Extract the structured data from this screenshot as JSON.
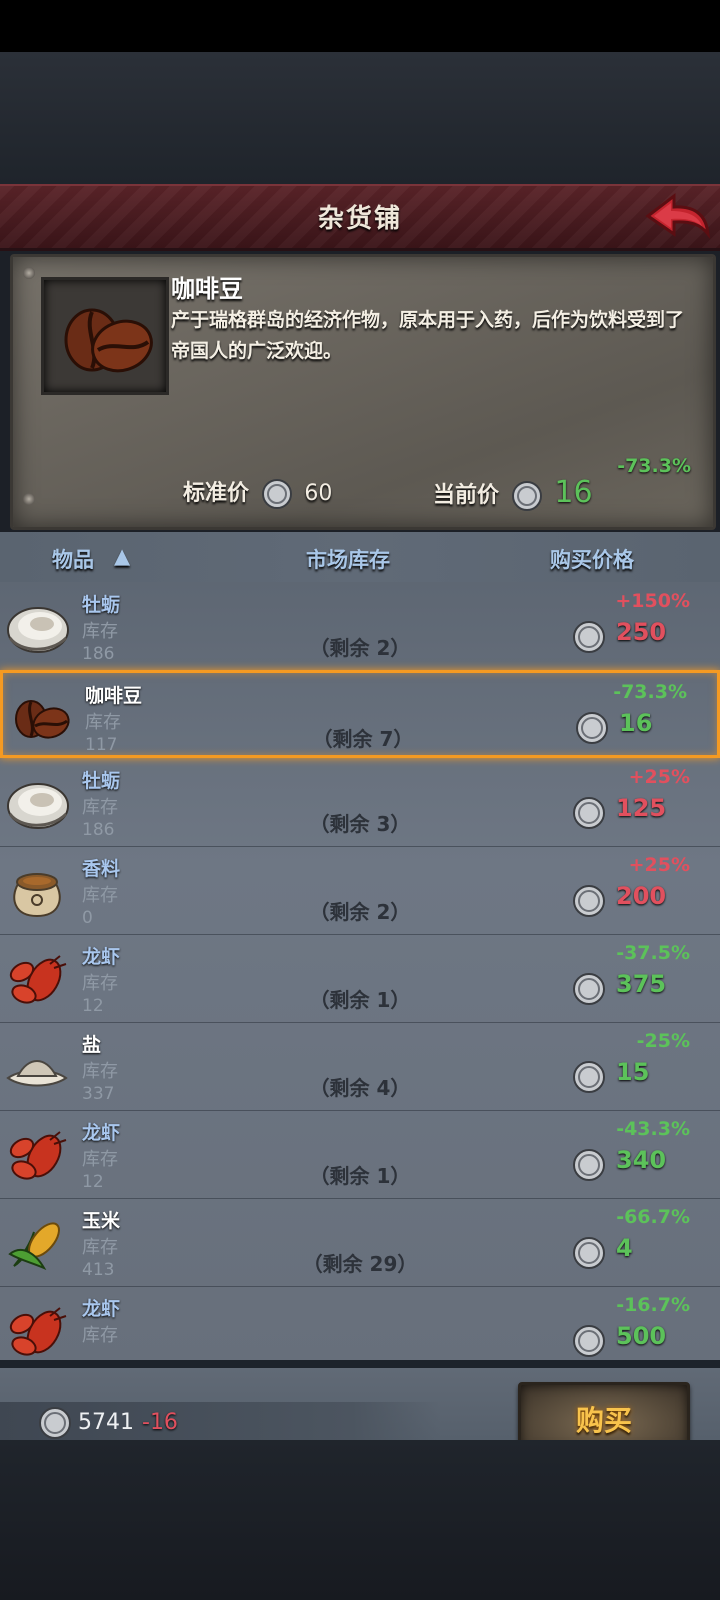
{
  "header": {
    "title": "杂货铺"
  },
  "detail": {
    "name": "咖啡豆",
    "description": "产于瑞格群岛的经济作物，原本用于入药，后作为饮料受到了帝国人的广泛欢迎。",
    "standard_price_label": "标准价",
    "standard_price": "60",
    "current_price_label": "当前价",
    "current_price": "16",
    "change": "-73.3%"
  },
  "columns": {
    "item": "物品",
    "stock": "市场库存",
    "price": "购买价格"
  },
  "stock_label": "库存",
  "rows": [
    {
      "name": "牡蛎",
      "icon": "oyster-icon",
      "stock": "186",
      "remaining": "（剩余 2）",
      "change": "+150%",
      "price": "250",
      "trend": "up",
      "name_color": "#a9c7ee"
    },
    {
      "name": "咖啡豆",
      "icon": "coffee-bean-icon",
      "stock": "117",
      "remaining": "（剩余 7）",
      "change": "-73.3%",
      "price": "16",
      "trend": "down",
      "name_color": "#ffffff"
    },
    {
      "name": "牡蛎",
      "icon": "oyster-icon",
      "stock": "186",
      "remaining": "（剩余 3）",
      "change": "+25%",
      "price": "125",
      "trend": "up",
      "name_color": "#a9c7ee"
    },
    {
      "name": "香料",
      "icon": "spice-sack-icon",
      "stock": "0",
      "remaining": "（剩余 2）",
      "change": "+25%",
      "price": "200",
      "trend": "up",
      "name_color": "#a9c7ee"
    },
    {
      "name": "龙虾",
      "icon": "lobster-icon",
      "stock": "12",
      "remaining": "（剩余 1）",
      "change": "-37.5%",
      "price": "375",
      "trend": "down",
      "name_color": "#a9c7ee"
    },
    {
      "name": "盐",
      "icon": "salt-icon",
      "stock": "337",
      "remaining": "（剩余 4）",
      "change": "-25%",
      "price": "15",
      "trend": "down",
      "name_color": "#ffffff"
    },
    {
      "name": "龙虾",
      "icon": "lobster-icon",
      "stock": "12",
      "remaining": "（剩余 1）",
      "change": "-43.3%",
      "price": "340",
      "trend": "down",
      "name_color": "#a9c7ee"
    },
    {
      "name": "玉米",
      "icon": "corn-icon",
      "stock": "413",
      "remaining": "（剩余 29）",
      "change": "-66.7%",
      "price": "4",
      "trend": "down",
      "name_color": "#ffffff"
    },
    {
      "name": "龙虾",
      "icon": "lobster-icon",
      "stock": "",
      "remaining": "",
      "change": "-16.7%",
      "price": "500",
      "trend": "down",
      "name_color": "#a9c7ee"
    }
  ],
  "selected_index": 1,
  "footer": {
    "money": "5741",
    "cost": "-16",
    "buy_label": "购买"
  },
  "colors": {
    "up": "#e1505e",
    "down": "#5cc25a",
    "highlight": "#f59a22"
  }
}
